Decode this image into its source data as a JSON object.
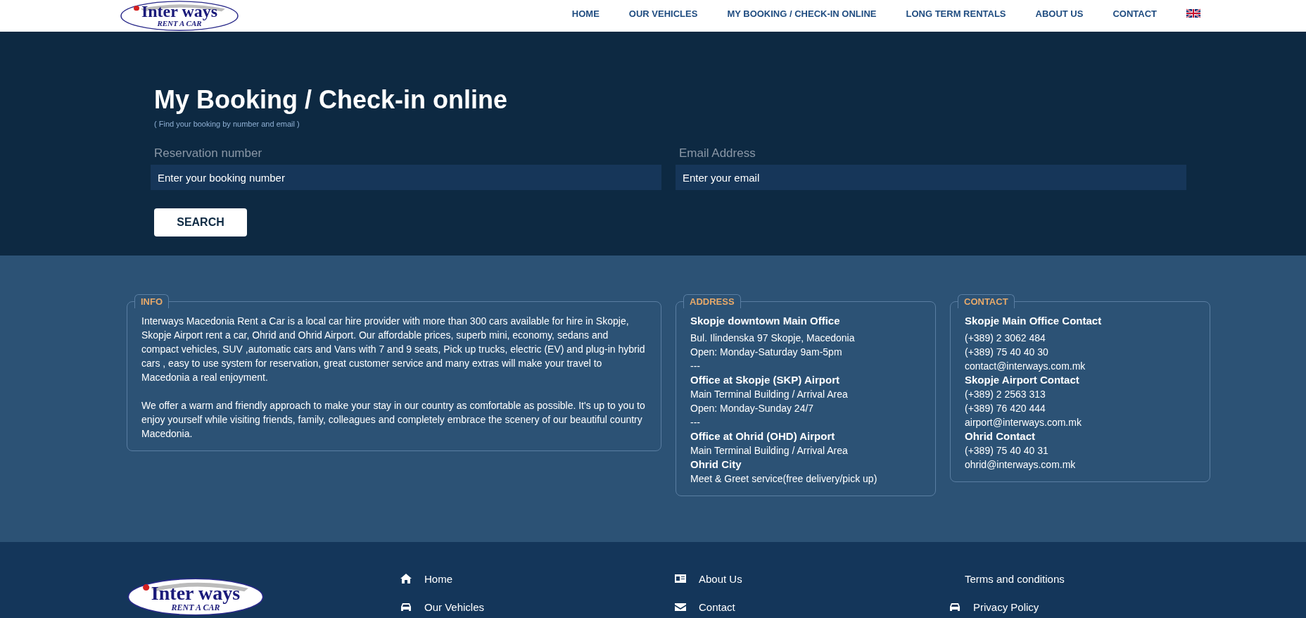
{
  "logo": {
    "name": "Inter ways",
    "tagline": "RENT A CAR"
  },
  "nav": [
    "HOME",
    "OUR VEHICLES",
    "MY BOOKING / CHECK-IN ONLINE",
    "LONG TERM RENTALS",
    "ABOUT US",
    "CONTACT"
  ],
  "page": {
    "title": "My Booking / Check-in online",
    "subtitle": "( Find your booking by number and email )"
  },
  "form": {
    "fields": [
      {
        "label": "Reservation number",
        "placeholder": "Enter your booking number"
      },
      {
        "label": "Email Address",
        "placeholder": "Enter your email"
      }
    ],
    "button": "SEARCH"
  },
  "info": {
    "title": "INFO",
    "paragraphs": [
      "Interways Macedonia Rent a Car is a local car hire provider with more than 300 cars available for hire in Skopje, Skopje Airport rent a car, Ohrid and Ohrid Airport. Our affordable prices, superb mini, economy, sedans and compact vehicles, SUV ,automatic cars and Vans with 7 and 9 seats, Pick up trucks, electric (EV) and plug-in hybrid cars , easy to use system for reservation, great customer service and many extras will make your travel to Macedonia a real enjoyment.",
      "We offer a warm and friendly approach to make your stay in our country as comfortable as possible. It's up to you to enjoy yourself while visiting friends, family, colleagues and completely embrace the scenery of our beautiful country Macedonia."
    ]
  },
  "address": {
    "title": "ADDRESS",
    "lines": [
      {
        "kind": "heading",
        "text": "Skopje downtown Main Office"
      },
      {
        "kind": "text",
        "text": "Bul. Ilindenska 97 Skopje, Macedonia"
      },
      {
        "kind": "text",
        "text": "Open: Monday-Saturday 9am-5pm"
      },
      {
        "kind": "text",
        "text": "---"
      },
      {
        "kind": "heading",
        "text": "Office at Skopje (SKP) Airport"
      },
      {
        "kind": "text",
        "text": "Main Terminal Building / Arrival Area"
      },
      {
        "kind": "text",
        "text": "Open: Monday-Sunday 24/7"
      },
      {
        "kind": "text",
        "text": "---"
      },
      {
        "kind": "heading",
        "text": "Office at Ohrid (OHD) Airport"
      },
      {
        "kind": "text",
        "text": "Main Terminal Building / Arrival Area"
      },
      {
        "kind": "heading",
        "text": "Ohrid City"
      },
      {
        "kind": "text",
        "text": "Meet & Greet service(free delivery/pick up)"
      }
    ]
  },
  "contact": {
    "title": "CONTACT",
    "lines": [
      {
        "kind": "heading",
        "text": "Skopje Main Office Contact"
      },
      {
        "kind": "text",
        "text": "(+389) 2 3062 484"
      },
      {
        "kind": "text",
        "text": "(+389) 75 40 40 30"
      },
      {
        "kind": "text",
        "text": "contact@interways.com.mk"
      },
      {
        "kind": "heading",
        "text": "Skopje Airport Contact"
      },
      {
        "kind": "text",
        "text": "(+389) 2 2563 313"
      },
      {
        "kind": "text",
        "text": "(+389) 76 420 444"
      },
      {
        "kind": "text",
        "text": "airport@interways.com.mk"
      },
      {
        "kind": "heading",
        "text": "Ohrid Contact"
      },
      {
        "kind": "text",
        "text": "(+389) 75 40 40 31"
      },
      {
        "kind": "text",
        "text": "ohrid@interways.com.mk"
      }
    ]
  },
  "footer": {
    "logo": {
      "name": "Inter ways",
      "tagline": "RENT A CAR"
    },
    "columns": [
      [
        {
          "label": "Home",
          "kind": "house"
        },
        {
          "label": "Our Vehicles",
          "kind": "car"
        }
      ],
      [
        {
          "label": "About Us",
          "kind": "card"
        },
        {
          "label": "Contact",
          "kind": "envelope"
        }
      ],
      [
        {
          "label": "Terms and conditions",
          "kind": "plain"
        },
        {
          "label": "Privacy Policy",
          "kind": "car"
        }
      ]
    ]
  }
}
